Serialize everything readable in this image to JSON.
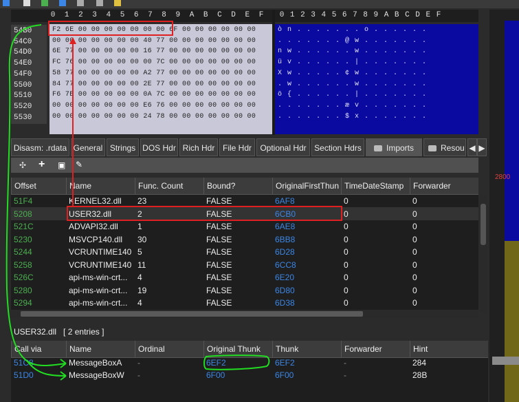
{
  "hex": {
    "col_headers": [
      "0",
      "1",
      "2",
      "3",
      "4",
      "5",
      "6",
      "7",
      "8",
      "9",
      "A",
      "B",
      "C",
      "D",
      "E",
      "F"
    ],
    "offsets": [
      "54B0",
      "54C0",
      "54D0",
      "54E0",
      "54F0",
      "5500",
      "5510",
      "5520",
      "5530"
    ],
    "rows": [
      "F2 6E 00 00 00 00 00 00 00 6F 00 00 00 00 00 00",
      "00 00 00 00 00 00 00 40 77 00 00 00 00 00 00 00",
      "6E 77 00 00 00 00 00 16 77 00 00 00 00 00 00 00",
      "FC 76 00 00 00 00 00 00 7C 00 00 00 00 00 00 00",
      "58 77 00 00 00 00 00 A2 77 00 00 00 00 00 00 00",
      "84 77 00 00 00 00 00 2E 77 00 00 00 00 00 00 00",
      "F6 7B 00 00 00 00 00 0A 7C 00 00 00 00 00 00 00",
      "00 00 00 00 00 00 00 E6 76 00 00 00 00 00 00 00",
      "00 00 00 00 00 00 00 24 78 00 00 00 00 00 00 00"
    ],
    "ascii": [
      "ò n . . . . . . . o . . . . . .",
      ". . . . . . . @ w . . . . . . .",
      "n w . . . . . . w . . . . . . .",
      "ü v . . . . . . | . . . . . . .",
      "X w . . . . . ¢ w . . . . . . .",
      ". w . . . . . . w . . . . . . .",
      "ö { . . . . . . | . . . . . . .",
      ". . . . . . . æ v . . . . . . .",
      ". . . . . . . $ x . . . . . . ."
    ]
  },
  "right_panel": {
    "value": "2800"
  },
  "tabs": [
    {
      "label": "Disasm: .rdata"
    },
    {
      "label": "General"
    },
    {
      "label": "Strings"
    },
    {
      "label": "DOS Hdr"
    },
    {
      "label": "Rich Hdr"
    },
    {
      "label": "File Hdr"
    },
    {
      "label": "Optional Hdr"
    },
    {
      "label": "Section Hdrs"
    },
    {
      "label": "Imports"
    },
    {
      "label": "Resou"
    }
  ],
  "imports_table": {
    "columns": [
      "Offset",
      "Name",
      "Func. Count",
      "Bound?",
      "OriginalFirstThun",
      "TimeDateStamp",
      "Forwarder"
    ],
    "rows": [
      [
        "51F4",
        "KERNEL32.dll",
        "23",
        "FALSE",
        "6AF8",
        "0",
        "0"
      ],
      [
        "5208",
        "USER32.dll",
        "2",
        "FALSE",
        "6CB0",
        "0",
        "0"
      ],
      [
        "521C",
        "ADVAPI32.dll",
        "1",
        "FALSE",
        "6AE8",
        "0",
        "0"
      ],
      [
        "5230",
        "MSVCP140.dll",
        "30",
        "FALSE",
        "6BB8",
        "0",
        "0"
      ],
      [
        "5244",
        "VCRUNTIME140...",
        "5",
        "FALSE",
        "6D28",
        "0",
        "0"
      ],
      [
        "5258",
        "VCRUNTIME140...",
        "11",
        "FALSE",
        "6CC8",
        "0",
        "0"
      ],
      [
        "526C",
        "api-ms-win-crt...",
        "4",
        "FALSE",
        "6E20",
        "0",
        "0"
      ],
      [
        "5280",
        "api-ms-win-crt...",
        "19",
        "FALSE",
        "6D80",
        "0",
        "0"
      ],
      [
        "5294",
        "api-ms-win-crt...",
        "4",
        "FALSE",
        "6D38",
        "0",
        "0"
      ]
    ]
  },
  "summary": {
    "dll": "USER32.dll",
    "entries": "[ 2 entries ]"
  },
  "functions_table": {
    "columns": [
      "Call via",
      "Name",
      "Ordinal",
      "Original Thunk",
      "Thunk",
      "Forwarder",
      "Hint"
    ],
    "rows": [
      [
        "51C8",
        "MessageBoxA",
        "-",
        "6EF2",
        "6EF2",
        "-",
        "284"
      ],
      [
        "51D0",
        "MessageBoxW",
        "-",
        "6F00",
        "6F00",
        "-",
        "28B"
      ]
    ]
  }
}
